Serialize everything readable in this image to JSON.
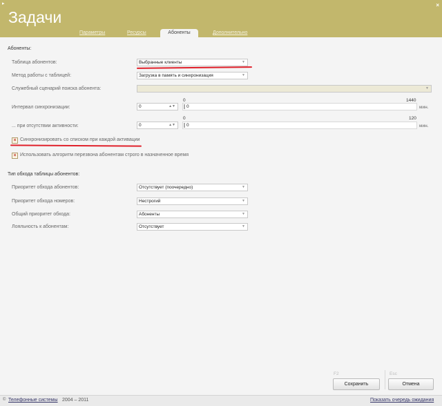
{
  "window": {
    "menu_glyph": "▸",
    "close_glyph": "×"
  },
  "title": "Задачи",
  "tabs": [
    {
      "label": "Параметры",
      "active": false
    },
    {
      "label": "Ресурсы",
      "active": false
    },
    {
      "label": "Абоненты",
      "active": true
    },
    {
      "label": "Дополнительно",
      "active": false
    }
  ],
  "subscribers": {
    "heading": "Абоненты:",
    "table_label": "Таблица абонентов:",
    "table_value": "Выбранные клиенты",
    "mode_label": "Метод работы с таблицей:",
    "mode_value": "Загрузка в память и синхронизация",
    "script_label": "Служебный сценарий поиска абонента:",
    "script_value": "",
    "sync_interval_label": "Интервал синхронизации:",
    "sync_interval_value": "0",
    "sync_slider_min": "0",
    "sync_slider_max": "1440",
    "sync_slider_value": "0",
    "sync_unit": "мин.",
    "inactive_label": "... при отсутствии активности:",
    "inactive_value": "0",
    "inactive_slider_min": "0",
    "inactive_slider_max": "120",
    "inactive_slider_value": "0",
    "inactive_unit": "мин.",
    "sync_each_activation_label": "Синхронизировать со списком при каждой активации",
    "sync_each_activation_checked": true,
    "strict_callback_label": "Использовать алгоритм перезвона абонентам строго в назначенное время",
    "strict_callback_checked": true
  },
  "traversal": {
    "heading": "Тип обхода таблицы абонентов:",
    "subscriber_priority_label": "Приоритет обхода абонентов:",
    "subscriber_priority_value": "Отсутствует (поочередно)",
    "number_priority_label": "Приоритет обхода номеров:",
    "number_priority_value": "Нестрогий",
    "overall_priority_label": "Общий приоритет обхода:",
    "overall_priority_value": "Абоненты",
    "loyalty_label": "Лояльность к абонентам:",
    "loyalty_value": "Отсутствует"
  },
  "buttons": {
    "save_hint": "F2",
    "save_label": "Сохранить",
    "cancel_hint": "Esc",
    "cancel_label": "Отмена"
  },
  "footer": {
    "icon_glyph": "©",
    "company_link": "Телефонные системы",
    "years": "2004 – 2011",
    "queue_link": "Показать очередь ожидания"
  },
  "glyphs": {
    "dropdown": "▼",
    "spinner": "▲▼",
    "check": "×"
  },
  "colors": {
    "header": "#c2b76c",
    "annotation_red": "#e0202a"
  }
}
